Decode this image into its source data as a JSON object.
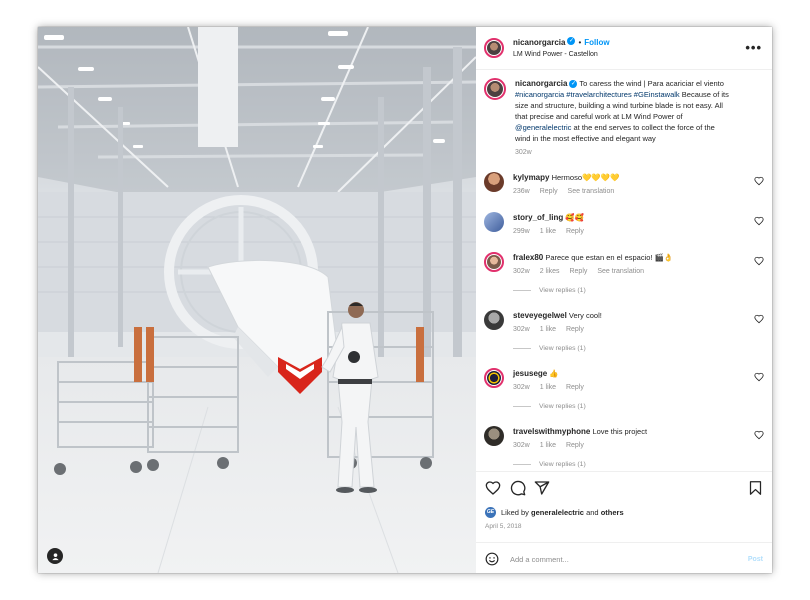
{
  "post": {
    "author": {
      "username": "nicanorgarcia",
      "verified": true,
      "follow_label": "Follow",
      "location": "LM Wind Power - Castellon"
    },
    "caption": {
      "username": "nicanorgarcia",
      "line1": "To caress the wind | Para acariciar el viento",
      "hashtags": "#nicanorgarcia #travelarchitectures #GEinstawalk",
      "text_part1": "Because of its size and structure, building a wind turbine blade is not easy. All that precise and careful work at LM Wind Power of",
      "mention": "@generalelectric",
      "text_part2": "at the end serves to collect the force of the wind in the most effective and elegant way",
      "time": "302w"
    },
    "comments": [
      {
        "username": "kylymapy",
        "text": "Hermoso💛💛💛💛",
        "time": "236w",
        "likes": "",
        "reply": "Reply",
        "extra": "See translation",
        "view_replies": ""
      },
      {
        "username": "story_of_ling",
        "text": "🥰🥰",
        "time": "299w",
        "likes": "1 like",
        "reply": "Reply",
        "extra": "",
        "view_replies": ""
      },
      {
        "username": "fralex80",
        "text": "Parece que estan en el espacio! 🎬👌",
        "time": "302w",
        "likes": "2 likes",
        "reply": "Reply",
        "extra": "See translation",
        "view_replies": "View replies (1)"
      },
      {
        "username": "steveyegelwel",
        "text": "Very cool!",
        "time": "302w",
        "likes": "1 like",
        "reply": "Reply",
        "extra": "",
        "view_replies": "View replies (1)"
      },
      {
        "username": "jesusege",
        "text": "👍",
        "time": "302w",
        "likes": "1 like",
        "reply": "Reply",
        "extra": "",
        "view_replies": "View replies (1)"
      },
      {
        "username": "travelswithmyphone",
        "text": "Love this project",
        "time": "302w",
        "likes": "1 like",
        "reply": "Reply",
        "extra": "",
        "view_replies": "View replies (1)"
      }
    ],
    "liked_by": {
      "prefix": "Liked by",
      "user": "generalelectric",
      "joiner": "and",
      "others": "others",
      "logo_text": "GE"
    },
    "date": "April 5, 2018",
    "add_comment": {
      "placeholder": "Add a comment...",
      "post_label": "Post"
    }
  },
  "icons": {
    "header_more": "more-options-icon",
    "like": "heart-icon",
    "comment": "comment-bubble-icon",
    "share": "paper-plane-icon",
    "save": "bookmark-icon",
    "emoji": "emoji-smile-icon",
    "photo_user_tag": "user-tag-icon"
  },
  "colors": {
    "accent": "#0095f6",
    "story_ring": "#e1306c",
    "muted_text": "#8e8e8e",
    "link_text": "#00376b",
    "post_button_disabled": "#b2dffc"
  }
}
